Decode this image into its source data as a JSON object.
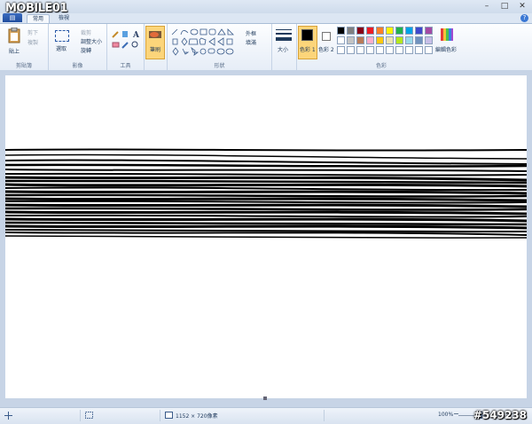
{
  "brand": {
    "text": "MOBILE01"
  },
  "window": {
    "minimize": "–",
    "maximize": "□",
    "close": "✕"
  },
  "tabs": [
    {
      "label": "常用",
      "active": true
    },
    {
      "label": "檢視",
      "active": false
    }
  ],
  "ribbon": {
    "clipboard": {
      "label": "剪貼簿",
      "paste": "貼上",
      "cut": "剪下",
      "copy": "複製"
    },
    "image": {
      "label": "影像",
      "select": "選取",
      "crop": "裁剪",
      "resize": "調整大小",
      "rotate": "旋轉"
    },
    "tools": {
      "label": "工具",
      "text_glyph": "A"
    },
    "brush": {
      "label": "筆刷"
    },
    "shapes": {
      "label": "形狀",
      "outline": "外框",
      "fill": "填滿"
    },
    "size": {
      "label": "大小"
    },
    "colors": {
      "label": "色彩",
      "color1": "色彩 1",
      "color2": "色彩 2",
      "edit": "編輯色彩",
      "palette_row1": [
        "#000000",
        "#7f7f7f",
        "#880015",
        "#ed1c24",
        "#ff7f27",
        "#fff200",
        "#22b14c",
        "#00a2e8",
        "#3f48cc",
        "#a349a4"
      ],
      "palette_row2": [
        "#ffffff",
        "#c3c3c3",
        "#b97a57",
        "#ffaec9",
        "#ffc90e",
        "#efe4b0",
        "#b5e61d",
        "#99d9ea",
        "#7092be",
        "#c8bfe7"
      ],
      "palette_row3": [
        "#ffffff",
        "#ffffff",
        "#ffffff",
        "#ffffff",
        "#ffffff",
        "#ffffff",
        "#ffffff",
        "#ffffff",
        "#ffffff",
        "#ffffff"
      ],
      "color1_value": "#000000",
      "color2_value": "#ffffff"
    }
  },
  "status": {
    "dimensions": "1152 × 720像素",
    "zoom": "100%"
  },
  "watermark": "#549238"
}
